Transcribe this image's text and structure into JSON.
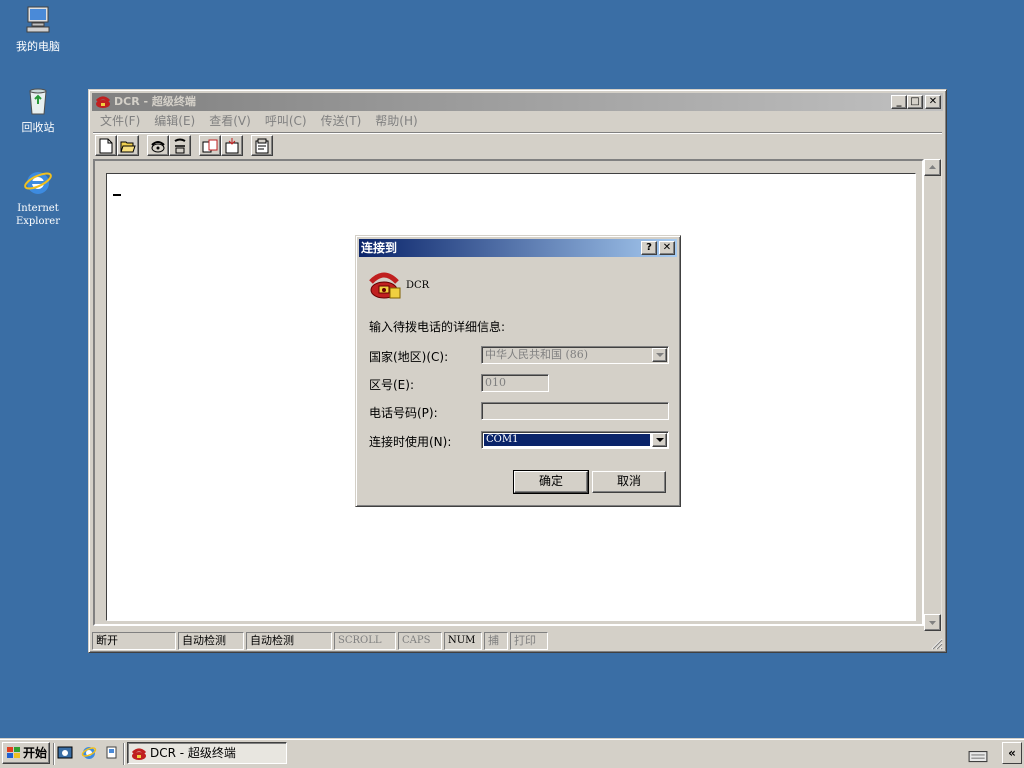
{
  "desktop": {
    "icons": [
      {
        "label": "我的电脑",
        "icon": "my-computer-icon"
      },
      {
        "label": "回收站",
        "icon": "recycle-bin-icon"
      },
      {
        "label": "Internet Explorer",
        "icon": "internet-explorer-icon"
      }
    ]
  },
  "window": {
    "title": "DCR - 超级终端",
    "menu": [
      "文件(F)",
      "编辑(E)",
      "查看(V)",
      "呼叫(C)",
      "传送(T)",
      "帮助(H)"
    ],
    "toolbar_icons": [
      "new-icon",
      "open-icon",
      "dial-icon",
      "disconnect-icon",
      "send-icon",
      "receive-icon",
      "properties-icon"
    ],
    "status": {
      "connection": "断开",
      "detect1": "自动检测",
      "detect2": "自动检测",
      "scroll": "SCROLL",
      "caps": "CAPS",
      "num": "NUM",
      "capture": "捕",
      "print": "打印"
    }
  },
  "dialog": {
    "title": "连接到",
    "connection_name": "DCR",
    "prompt": "输入待拨电话的详细信息:",
    "country_label": "国家(地区)(C):",
    "country_value": "中华人民共和国 (86)",
    "area_label": "区号(E):",
    "area_value": "010",
    "phone_label": "电话号码(P):",
    "phone_value": "",
    "connect_using_label": "连接时使用(N):",
    "connect_using_value": "COM1",
    "ok_label": "确定",
    "cancel_label": "取消"
  },
  "taskbar": {
    "start_label": "开始",
    "task_label": "DCR - 超级终端",
    "chevron": "«"
  },
  "colors": {
    "desktop": "#3a6ea5",
    "active_title": "#0a246a",
    "inactive_title": "#808080",
    "face": "#d4d0c8"
  }
}
